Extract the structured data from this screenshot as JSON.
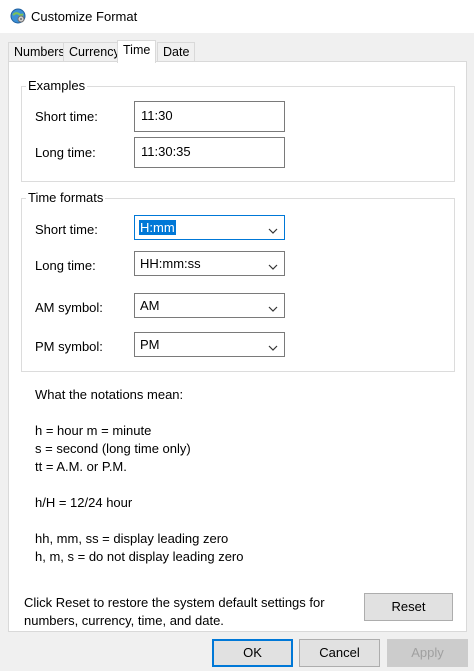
{
  "window": {
    "title": "Customize Format"
  },
  "tabs": [
    {
      "label": "Numbers"
    },
    {
      "label": "Currency"
    },
    {
      "label": "Time"
    },
    {
      "label": "Date"
    }
  ],
  "examples": {
    "legend": "Examples",
    "short_time_label": "Short time:",
    "short_time_value": "11:30",
    "long_time_label": "Long time:",
    "long_time_value": "11:30:35"
  },
  "time_formats": {
    "legend": "Time formats",
    "short_time_label": "Short time:",
    "short_time_value": "H:mm",
    "long_time_label": "Long time:",
    "long_time_value": "HH:mm:ss",
    "am_label": "AM symbol:",
    "am_value": "AM",
    "pm_label": "PM symbol:",
    "pm_value": "PM"
  },
  "notations": {
    "heading": "What the notations mean:",
    "line1": "h = hour   m = minute",
    "line2": "s = second (long time only)",
    "line3": "tt = A.M. or P.M.",
    "line4": "h/H = 12/24 hour",
    "line5": "hh, mm, ss = display leading zero",
    "line6": "h, m, s = do not display leading zero"
  },
  "reset": {
    "text1": "Click Reset to restore the system default settings for",
    "text2": "numbers, currency, time, and date.",
    "button": "Reset"
  },
  "footer": {
    "ok": "OK",
    "cancel": "Cancel",
    "apply": "Apply"
  },
  "icons": {
    "app": "globe-gear-icon",
    "dropdown": "chevron-down-icon"
  },
  "colors": {
    "accent": "#0078d7",
    "panel": "#ffffff",
    "window": "#f0f0f0"
  }
}
